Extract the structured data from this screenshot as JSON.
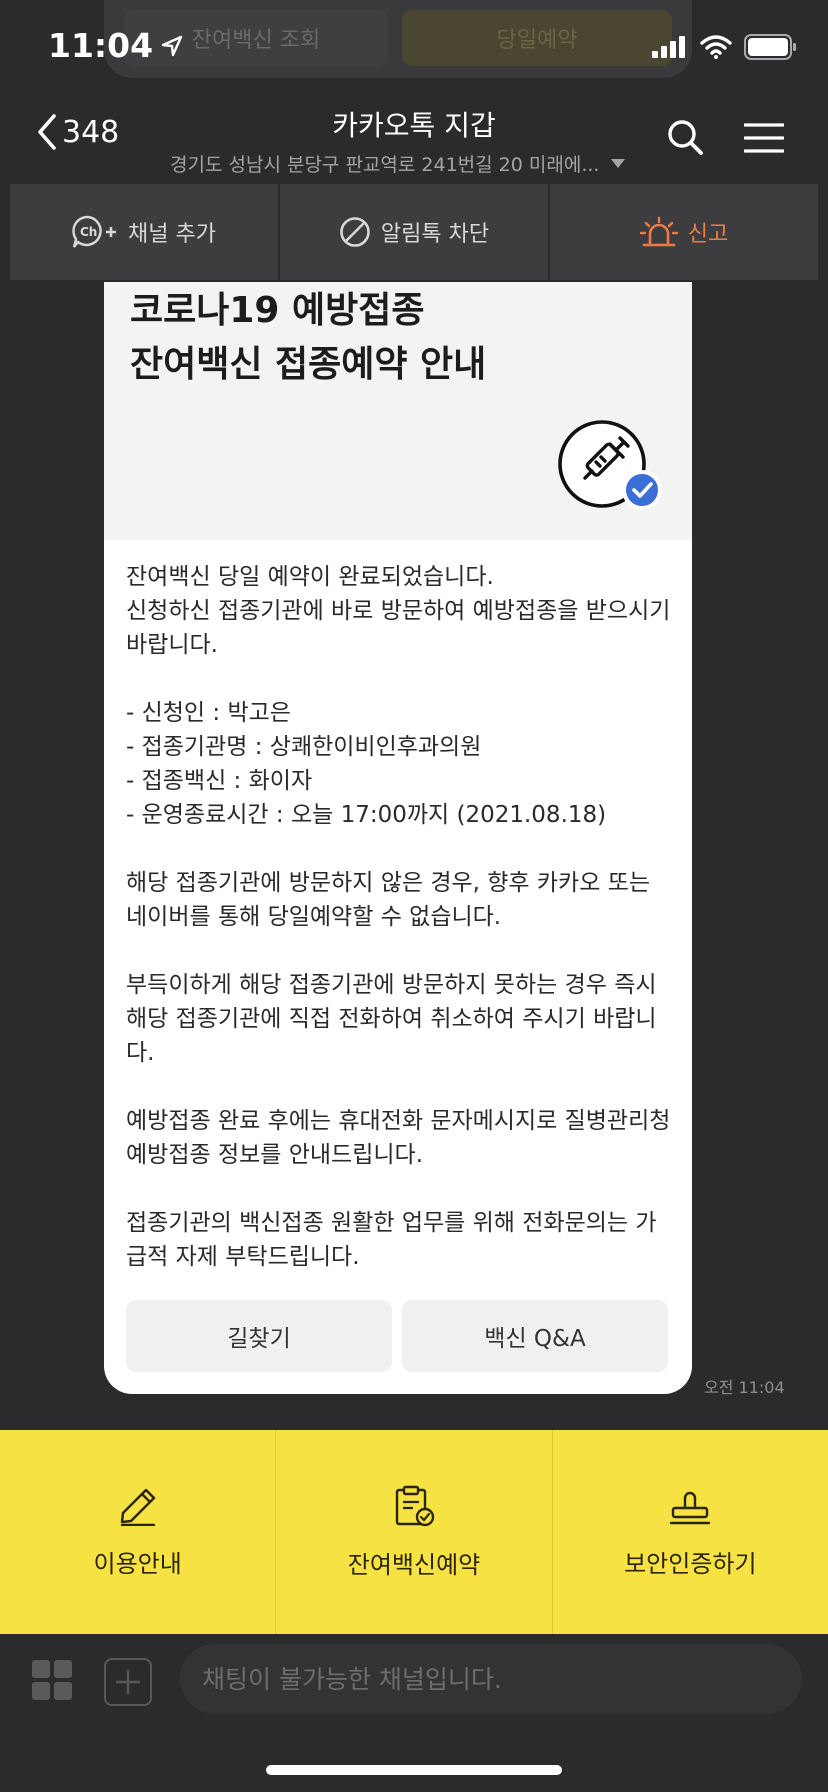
{
  "peek_card": {
    "left_button": "잔여백신 조회",
    "right_button": "당일예약"
  },
  "status_bar": {
    "time": "11:04"
  },
  "header": {
    "back_count": "348",
    "title": "카카오톡 지갑",
    "subtitle": "경기도 성남시 분당구 판교역로 241번길 20 미래에..."
  },
  "action_bar": {
    "add_channel": "채널 추가",
    "block_alert": "알림톡 차단",
    "report": "신고"
  },
  "message_card": {
    "title_line1": "코로나19 예방접종",
    "title_line2": "잔여백신 접종예약 안내",
    "body": "잔여백신 당일 예약이 완료되었습니다.\n신청하신 접종기관에 바로 방문하여 예방접종을 받으시기 바랍니다.\n\n- 신청인 : 박고은\n- 접종기관명 : 상쾌한이비인후과의원\n- 접종백신 : 화이자\n- 운영종료시간 : 오늘 17:00까지 (2021.08.18)\n\n해당 접종기관에 방문하지 않은 경우, 향후 카카오 또는 네이버를 통해 당일예약할 수 없습니다.\n\n부득이하게 해당 접종기관에 방문하지 못하는 경우 즉시 해당 접종기관에 직접 전화하여 취소하여 주시기 바랍니다.\n\n예방접종 완료 후에는 휴대전화 문자메시지로 질병관리청 예방접종 정보를 안내드립니다.\n\n접종기관의 백신접종 원활한 업무를 위해 전화문의는 가급적 자제 부탁드립니다.",
    "button_directions": "길찾기",
    "button_qa": "백신 Q&A",
    "time": "오전 11:04"
  },
  "yellow_menu": {
    "items": [
      {
        "label": "이용안내",
        "icon": "pencil-icon"
      },
      {
        "label": "잔여백신예약",
        "icon": "clipboard-check-icon"
      },
      {
        "label": "보안인증하기",
        "icon": "stamp-icon"
      }
    ]
  },
  "input_bar": {
    "placeholder": "채팅이 불가능한 채널입니다."
  },
  "colors": {
    "background": "#2b2b2e",
    "accent_yellow": "#f7e244",
    "report_orange": "#f07b47",
    "check_blue": "#3a6fd8"
  }
}
